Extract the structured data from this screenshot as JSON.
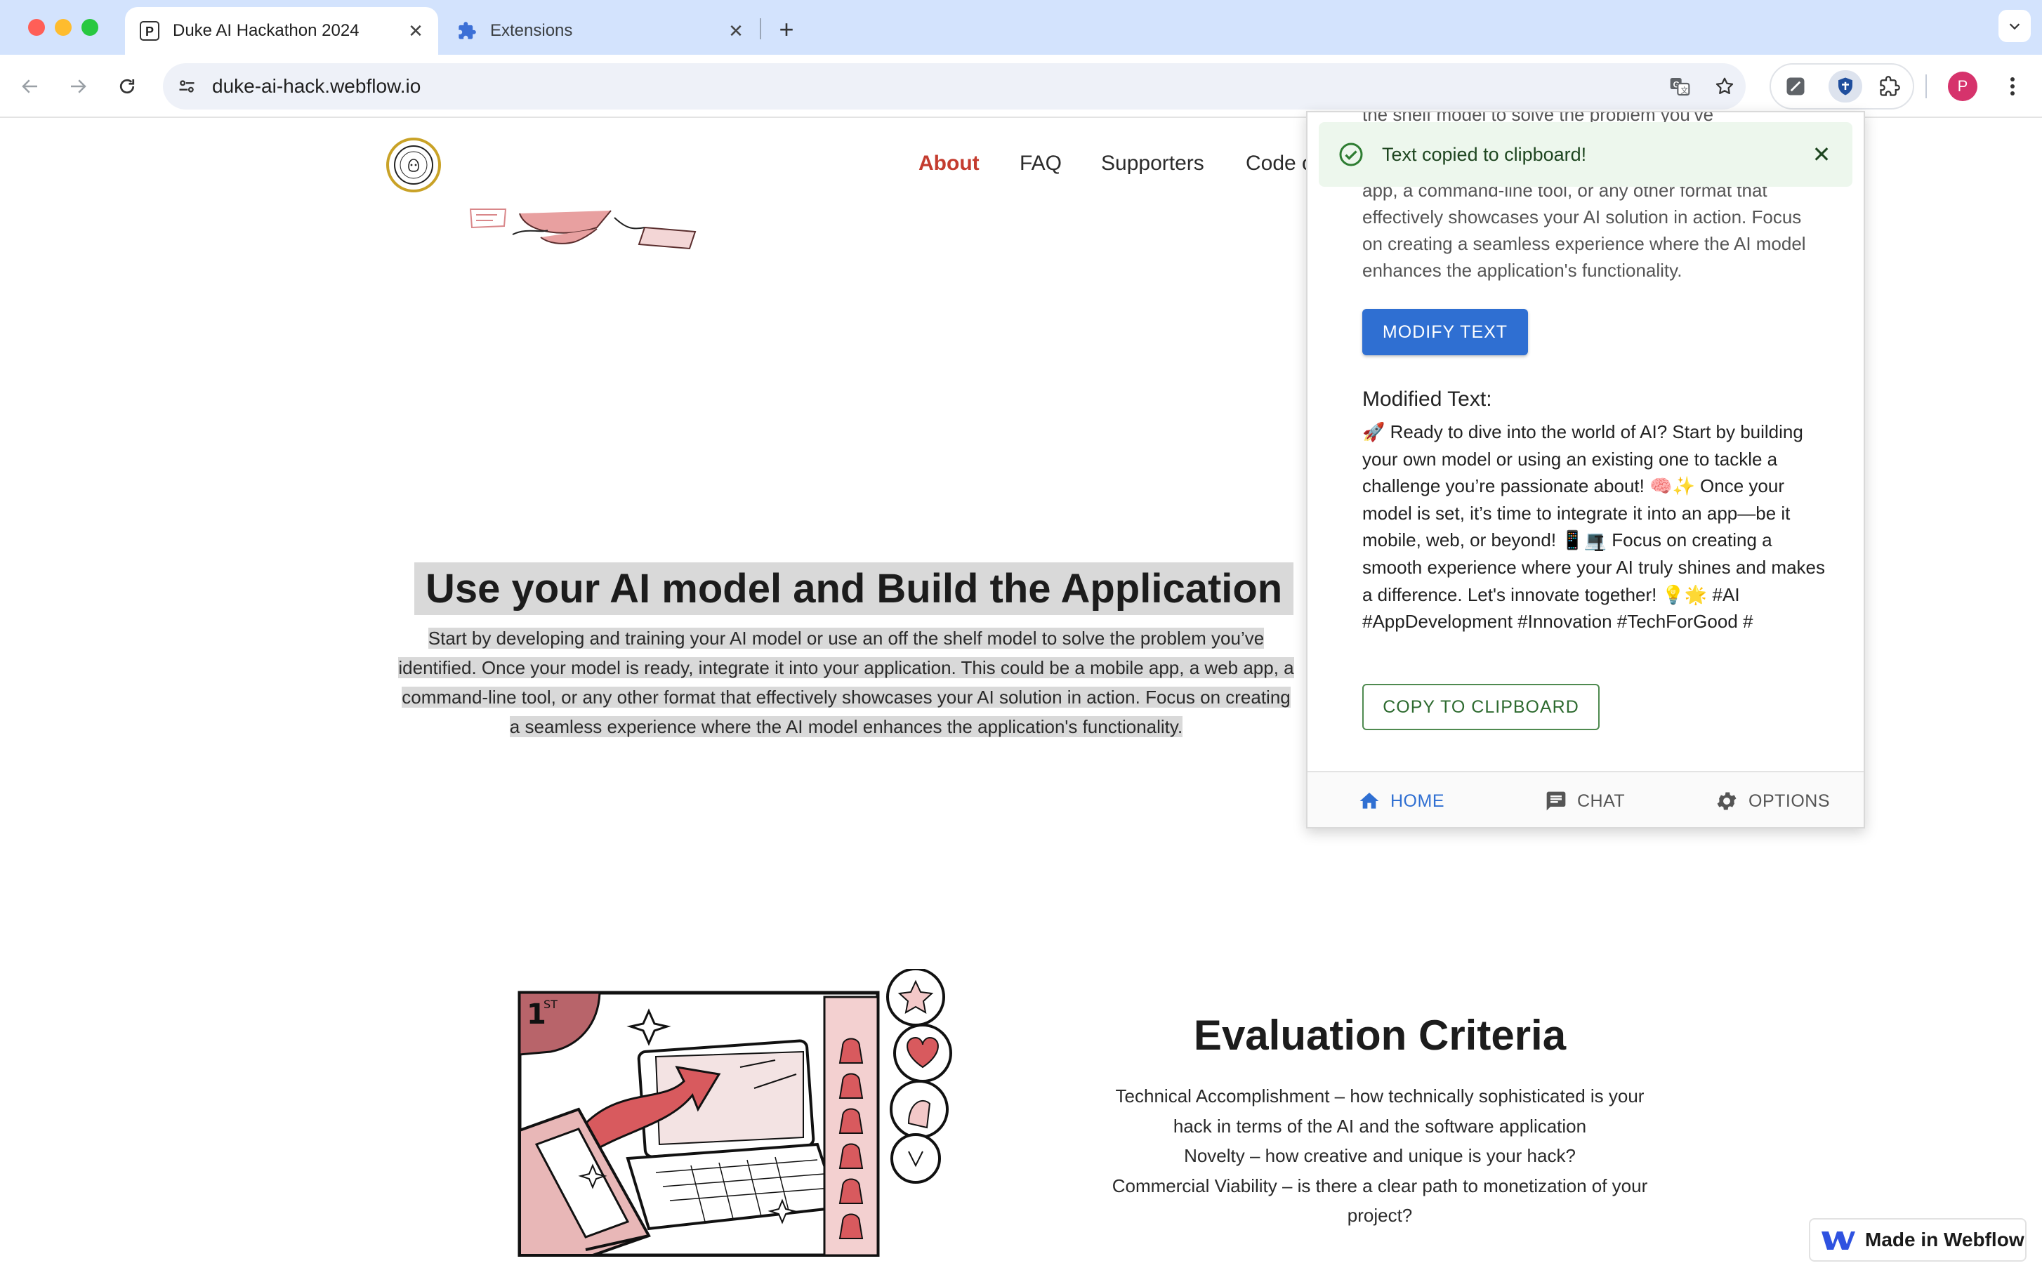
{
  "browser": {
    "tabs": [
      {
        "title": "Duke AI Hackathon 2024",
        "favicon": "P",
        "active": true
      },
      {
        "title": "Extensions",
        "favicon": "puzzle-icon",
        "active": false
      }
    ],
    "url": "duke-ai-hack.webflow.io",
    "profile_initial": "P"
  },
  "site": {
    "nav": {
      "items": [
        "About",
        "FAQ",
        "Supporters",
        "Code of Conduct"
      ],
      "active": "About"
    },
    "section": {
      "title": "Use your AI model and Build the Application",
      "body_lines": [
        "Start by developing and training your AI model or use an off the shelf model to solve the problem you’ve",
        "identified. Once your model is ready, integrate it into your application. This could be a mobile app, a web app, a",
        "command-line tool, or any other format that effectively showcases your AI solution in action. Focus on creating",
        "a seamless experience where the AI model enhances the application's functionality."
      ]
    },
    "evaluation": {
      "title": "Evaluation Criteria",
      "lines": [
        "Technical Accomplishment – how technically sophisticated is your",
        "hack in terms of the AI and the software application",
        "Novelty – how creative and unique is your hack?",
        "Commercial Viability – is there a clear path to monetization of your",
        "project?"
      ]
    },
    "badge": "Made in Webflow"
  },
  "popup": {
    "partial_top": "the shelf model to solve the problem you’ve",
    "original_tail": "app, a command-line tool, or any other format that effectively showcases your AI solution in action. Focus on creating a seamless experience where the AI model enhances the application's functionality.",
    "toast": "Text copied to clipboard!",
    "modify_button": "MODIFY TEXT",
    "modified_label": "Modified Text:",
    "modified_text": "🚀 Ready to dive into the world of AI? Start by building your own model or using an existing one to tackle a challenge you’re passionate about! 🧠✨ Once your model is set, it’s time to integrate it into an app—be it mobile, web, or beyond! 📱💻 Focus on creating a smooth experience where your AI truly shines and makes a difference. Let's innovate together! 💡🌟 #AI #AppDevelopment #Innovation #TechForGood #",
    "copy_button": "COPY TO CLIPBOARD",
    "nav": [
      {
        "label": "HOME",
        "icon": "home-icon",
        "active": true
      },
      {
        "label": "CHAT",
        "icon": "chat-icon",
        "active": false
      },
      {
        "label": "OPTIONS",
        "icon": "gear-icon",
        "active": false
      }
    ]
  },
  "colors": {
    "nav_active": "#c43c2f",
    "primary_button": "#2f6fd2",
    "success": "#2e6b30"
  }
}
